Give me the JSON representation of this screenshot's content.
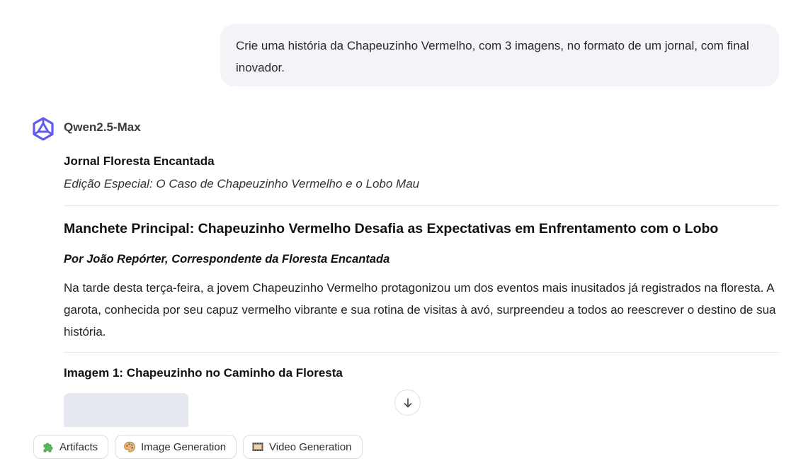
{
  "user_message": {
    "text": "Crie uma história da Chapeuzinho Vermelho, com 3 imagens, no formato de um jornal, com final inovador."
  },
  "assistant": {
    "model_name": "Qwen2.5-Max",
    "logo_icon": "qwen-logo-icon",
    "brand_color": "#615ced"
  },
  "article": {
    "newspaper_name": "Jornal Floresta Encantada",
    "edition": "Edição Especial: O Caso de Chapeuzinho Vermelho e o Lobo Mau",
    "headline": "Manchete Principal: Chapeuzinho Vermelho Desafia as Expectativas em Enfrentamento com o Lobo",
    "byline": "Por João Repórter, Correspondente da Floresta Encantada",
    "paragraph_1": "Na tarde desta terça-feira, a jovem Chapeuzinho Vermelho protagonizou um dos eventos mais inusitados já registrados na floresta. A garota, conhecida por seu capuz vermelho vibrante e sua rotina de visitas à avó, surpreendeu a todos ao reescrever o destino de sua história.",
    "image_1_heading": "Imagem 1: Chapeuzinho no Caminho da Floresta"
  },
  "controls": {
    "scroll_down_icon": "arrow-down-icon"
  },
  "toolbar": {
    "artifacts_label": "Artifacts",
    "artifacts_icon": "puzzle-icon",
    "image_generation_label": "Image Generation",
    "image_generation_icon": "palette-icon",
    "video_generation_label": "Video Generation",
    "video_generation_icon": "film-icon"
  }
}
